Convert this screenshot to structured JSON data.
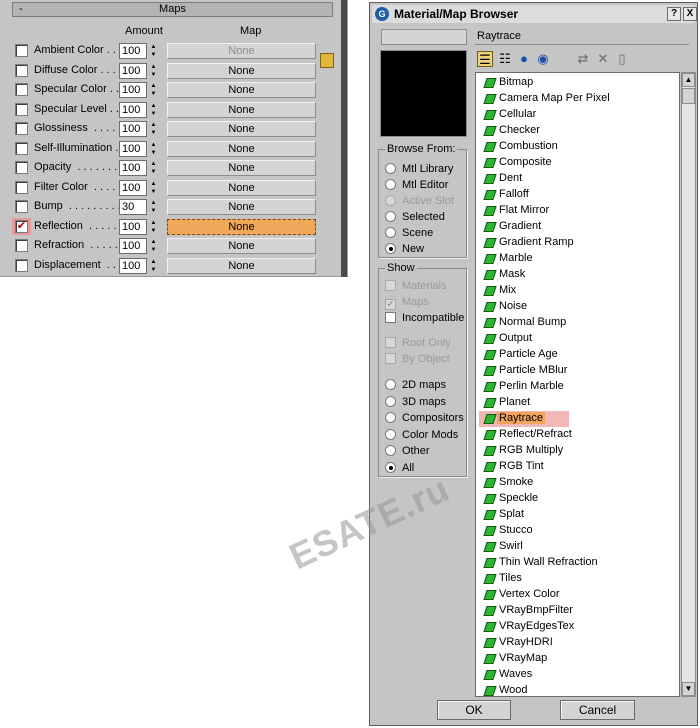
{
  "maps_panel": {
    "title": "Maps",
    "toggle": "-",
    "col_amount": "Amount",
    "col_map": "Map",
    "rows": [
      {
        "label": "Ambient Color . . .",
        "checked": false,
        "amount": "100",
        "map": "None",
        "dim": true
      },
      {
        "label": "Diffuse Color . . .",
        "checked": false,
        "amount": "100",
        "map": "None",
        "dim": false
      },
      {
        "label": "Specular Color . .",
        "checked": false,
        "amount": "100",
        "map": "None",
        "dim": false
      },
      {
        "label": "Specular Level . .",
        "checked": false,
        "amount": "100",
        "map": "None",
        "dim": false
      },
      {
        "label": "Glossiness  . . . . .",
        "checked": false,
        "amount": "100",
        "map": "None",
        "dim": false
      },
      {
        "label": "Self-Illumination .",
        "checked": false,
        "amount": "100",
        "map": "None",
        "dim": false
      },
      {
        "label": "Opacity  . . . . . . .",
        "checked": false,
        "amount": "100",
        "map": "None",
        "dim": false
      },
      {
        "label": "Filter Color  . . . .",
        "checked": false,
        "amount": "100",
        "map": "None",
        "dim": false
      },
      {
        "label": "Bump  . . . . . . . . .",
        "checked": false,
        "amount": "30",
        "map": "None",
        "dim": false
      },
      {
        "label": "Reflection  . . . . .",
        "checked": true,
        "amount": "100",
        "map": "None",
        "dim": false,
        "highlight": true
      },
      {
        "label": "Refraction  . . . . .",
        "checked": false,
        "amount": "100",
        "map": "None",
        "dim": false
      },
      {
        "label": "Displacement  . .",
        "checked": false,
        "amount": "100",
        "map": "None",
        "dim": false
      }
    ]
  },
  "browser": {
    "title": "Material/Map Browser",
    "help_btn": "?",
    "close_btn": "X",
    "name_value": "Raytrace",
    "browse_from": {
      "legend": "Browse From:",
      "options": [
        {
          "label": "Mtl Library",
          "selected": false,
          "disabled": false
        },
        {
          "label": "Mtl Editor",
          "selected": false,
          "disabled": false
        },
        {
          "label": "Active Slot",
          "selected": false,
          "disabled": true
        },
        {
          "label": "Selected",
          "selected": false,
          "disabled": false
        },
        {
          "label": "Scene",
          "selected": false,
          "disabled": false
        },
        {
          "label": "New",
          "selected": true,
          "disabled": false
        }
      ]
    },
    "show": {
      "legend": "Show",
      "options": [
        {
          "label": "Materials",
          "checked": false,
          "disabled": true
        },
        {
          "label": "Maps",
          "checked": true,
          "disabled": true
        },
        {
          "label": "Incompatible",
          "checked": false,
          "disabled": false
        }
      ],
      "options2": [
        {
          "label": "Root Only",
          "checked": false,
          "disabled": true
        },
        {
          "label": "By Object",
          "checked": false,
          "disabled": true
        }
      ],
      "radios": [
        {
          "label": "2D maps",
          "selected": false
        },
        {
          "label": "3D maps",
          "selected": false
        },
        {
          "label": "Compositors",
          "selected": false
        },
        {
          "label": "Color Mods",
          "selected": false
        },
        {
          "label": "Other",
          "selected": false
        },
        {
          "label": "All",
          "selected": true
        }
      ]
    },
    "maps": [
      "Bitmap",
      "Camera Map Per Pixel",
      "Cellular",
      "Checker",
      "Combustion",
      "Composite",
      "Dent",
      "Falloff",
      "Flat Mirror",
      "Gradient",
      "Gradient Ramp",
      "Marble",
      "Mask",
      "Mix",
      "Noise",
      "Normal Bump",
      "Output",
      "Particle Age",
      "Particle MBlur",
      "Perlin Marble",
      "Planet",
      "Raytrace",
      "Reflect/Refract",
      "RGB Multiply",
      "RGB Tint",
      "Smoke",
      "Speckle",
      "Splat",
      "Stucco",
      "Swirl",
      "Thin Wall Refraction",
      "Tiles",
      "Vertex Color",
      "VRayBmpFilter",
      "VRayEdgesTex",
      "VRayHDRI",
      "VRayMap",
      "Waves",
      "Wood"
    ],
    "selected_map": "Raytrace",
    "ok_label": "OK",
    "cancel_label": "Cancel"
  },
  "watermark": "ESATE.ru",
  "colors": {
    "panel": "#c5c5c5",
    "highlight_orange": "#f3a35c",
    "highlight_pink": "#f2b8b8",
    "map_icon": "#2fb52f"
  }
}
